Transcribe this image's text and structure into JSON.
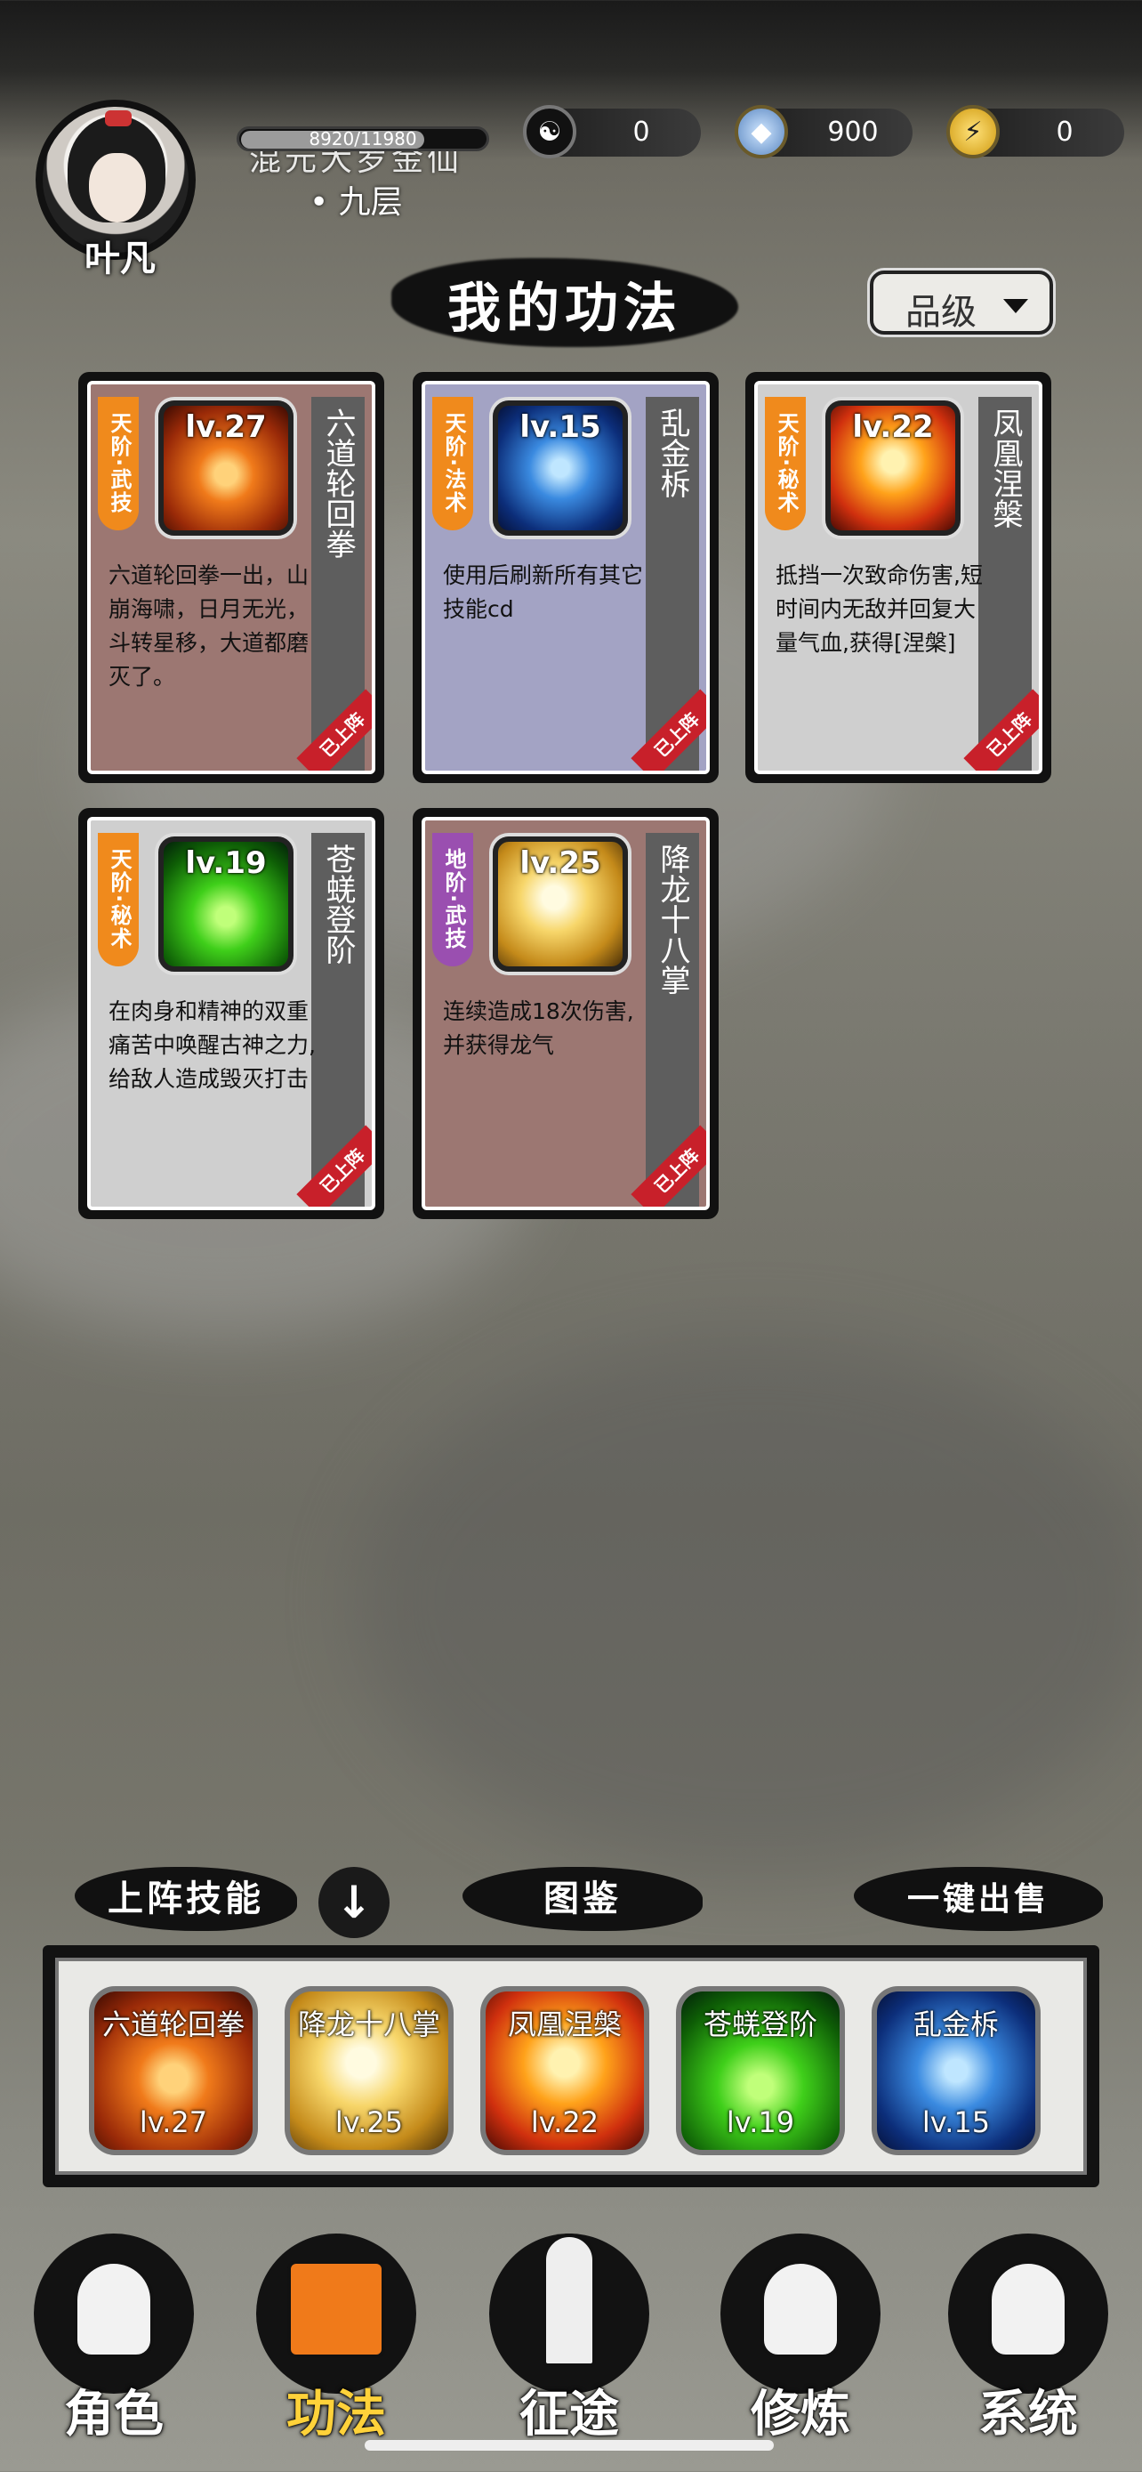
{
  "player": {
    "name": "叶凡",
    "hp_text": "8920/11980",
    "hp_fraction": 0.745,
    "realm_line1": "混元大罗金仙",
    "realm_line2": "• 九层"
  },
  "resources": [
    {
      "icon": "yin-yang-icon",
      "value": "0"
    },
    {
      "icon": "crystal-icon",
      "value": "900"
    },
    {
      "icon": "lightning-icon",
      "value": "0"
    }
  ],
  "page_title": "我的功法",
  "grade_filter": {
    "label": "品级"
  },
  "skills": [
    {
      "grade": "天阶·武技",
      "grade_color": "#f08a1c",
      "level": "lv.27",
      "name": "六道轮回拳",
      "desc": "六道轮回拳一出，山崩海啸，日月无光，斗转星移，大道都磨灭了。",
      "bg": "#9c7772",
      "art": "fire-fist",
      "equipped": "已上阵"
    },
    {
      "grade": "天阶·法术",
      "grade_color": "#f08a1c",
      "level": "lv.15",
      "name": "乱金柝",
      "desc": "使用后刷新所有其它技能cd",
      "bg": "#a3a3c4",
      "art": "blue-star",
      "equipped": "已上阵"
    },
    {
      "grade": "天阶·秘术",
      "grade_color": "#f08a1c",
      "level": "lv.22",
      "name": "凤凰涅槃",
      "desc": "抵挡一次致命伤害,短时间内无敌并回复大量气血,获得[涅槃]",
      "bg": "#cfcfcf",
      "art": "phoenix",
      "equipped": "已上阵"
    },
    {
      "grade": "天阶·秘术",
      "grade_color": "#f08a1c",
      "level": "lv.19",
      "name": "苍蜣登阶",
      "desc": "在肉身和精神的双重痛苦中唤醒古神之力,给敌人造成毁灭打击",
      "bg": "#cfcfcf",
      "art": "green-flame",
      "equipped": "已上阵"
    },
    {
      "grade": "地阶·武技",
      "grade_color": "#9a4fb0",
      "level": "lv.25",
      "name": "降龙十八掌",
      "desc": "连续造成18次伤害,并获得龙气",
      "bg": "#9c7772",
      "art": "golden-palm",
      "equipped": "已上阵"
    }
  ],
  "actions": {
    "equipped_label": "上阵技能",
    "codex_label": "图鉴",
    "sell_label": "一键出售"
  },
  "equipped_slots": [
    {
      "name": "六道轮回拳",
      "level": "lv.27",
      "art": "fire-fist"
    },
    {
      "name": "降龙十八掌",
      "level": "lv.25",
      "art": "golden-palm"
    },
    {
      "name": "凤凰涅槃",
      "level": "lv.22",
      "art": "phoenix"
    },
    {
      "name": "苍蜣登阶",
      "level": "lv.19",
      "art": "green-flame"
    },
    {
      "name": "乱金柝",
      "level": "lv.15",
      "art": "blue-star"
    }
  ],
  "nav": [
    {
      "label": "角色",
      "icon": "hooded-figure-icon",
      "active": false
    },
    {
      "label": "功法",
      "icon": "book-scroll-icon",
      "active": true
    },
    {
      "label": "征途",
      "icon": "sword-emblem-icon",
      "active": false
    },
    {
      "label": "修炼",
      "icon": "meditating-figure-icon",
      "active": false
    },
    {
      "label": "系统",
      "icon": "mascot-icon",
      "active": false
    }
  ],
  "colors": {
    "equipped_ribbon": "#c8202a",
    "nav_active": "#ffd23a"
  }
}
